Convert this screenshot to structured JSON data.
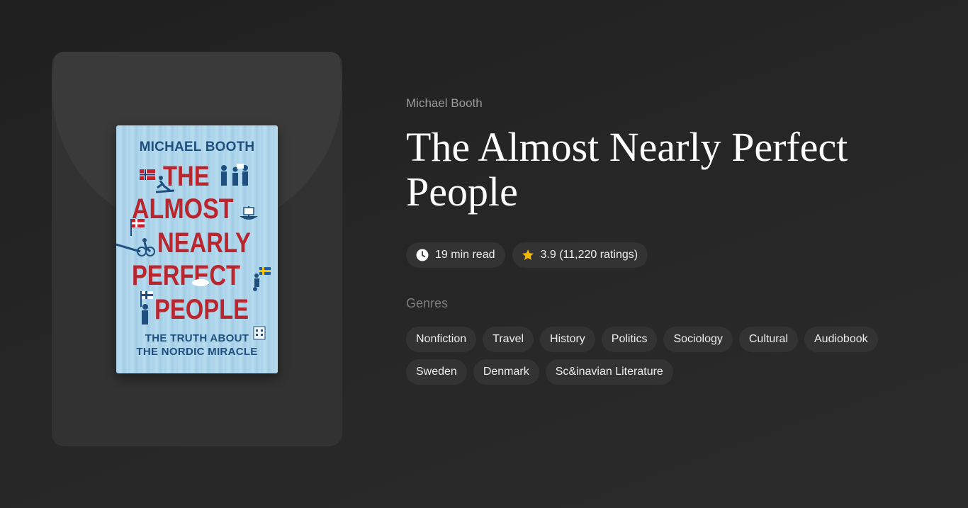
{
  "cover": {
    "author": "MICHAEL BOOTH",
    "title_lines": [
      "THE",
      "ALMOST",
      "NEARLY",
      "PERFECT",
      "PEOPLE"
    ],
    "subtitle_lines": [
      "THE TRUTH ABOUT",
      "THE NORDIC MIRACLE"
    ]
  },
  "book": {
    "author": "Michael Booth",
    "title": "The Almost Nearly Perfect People",
    "read_time": "19 min read",
    "rating": "3.9 (11,220 ratings)"
  },
  "icons": {
    "read_time": "clock-icon",
    "rating": "star-icon"
  },
  "colors": {
    "accent_star": "#f5b700",
    "cover_blue": "#a9d2e9",
    "cover_red": "#b9262e",
    "cover_navy": "#1f4f7e"
  },
  "genres": {
    "label": "Genres",
    "items": [
      "Nonfiction",
      "Travel",
      "History",
      "Politics",
      "Sociology",
      "Cultural",
      "Audiobook",
      "Sweden",
      "Denmark",
      "Sc&inavian Literature"
    ]
  }
}
